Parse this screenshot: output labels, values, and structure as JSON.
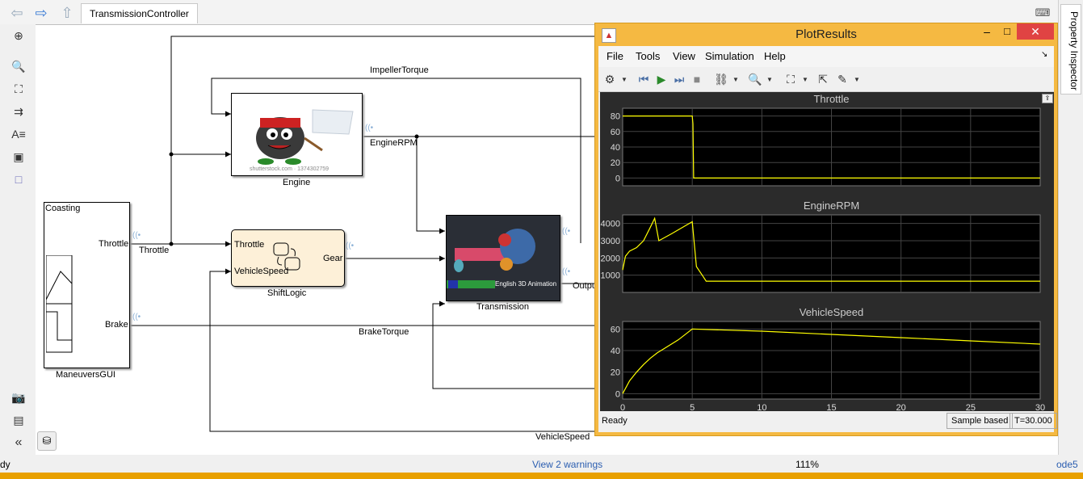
{
  "window": {
    "tab_title": "TransmissionController"
  },
  "property_inspector": {
    "label": "Property Inspector"
  },
  "status_bar": {
    "left": "dy",
    "warnings": "View 2 warnings",
    "zoom": "111%",
    "solver": "ode5"
  },
  "blocks": {
    "maneuvers": {
      "name": "ManeuversGUI",
      "header": "Coasting",
      "port_throttle": "Throttle",
      "port_brake": "Brake"
    },
    "engine": {
      "name": "Engine",
      "watermark": "shutterstock.com · 1374302759"
    },
    "shiftlogic": {
      "name": "ShiftLogic",
      "in_throttle": "Throttle",
      "in_vehiclespeed": "VehicleSpeed",
      "out_gear": "Gear"
    },
    "transmission": {
      "name": "Transmission",
      "badge": "English 3D Animation"
    }
  },
  "signals": {
    "impeller_torque": "ImpellerTorque",
    "engine_rpm": "EngineRPM",
    "throttle": "Throttle",
    "brake_torque": "BrakeTorque",
    "output": "Outpu",
    "vehicle_speed": "VehicleSpeed"
  },
  "plot_window": {
    "title": "PlotResults",
    "menu": [
      "File",
      "Tools",
      "View",
      "Simulation",
      "Help"
    ],
    "status_left": "Ready",
    "sample_mode": "Sample based",
    "time": "T=30.000"
  },
  "colors": {
    "trace": "#ffff00",
    "plot_bg": "#000000",
    "titlebar": "#f5b942",
    "close": "#e04343"
  },
  "chart_data": [
    {
      "type": "line",
      "title": "Throttle",
      "xlim": [
        0,
        30
      ],
      "ylim": [
        -10,
        90
      ],
      "yticks": [
        0,
        20,
        40,
        60,
        80
      ],
      "x": [
        0,
        5,
        5.05,
        5.1,
        30
      ],
      "y": [
        80,
        80,
        70,
        0,
        0
      ]
    },
    {
      "type": "line",
      "title": "EngineRPM",
      "xlim": [
        0,
        30
      ],
      "ylim": [
        0,
        4500
      ],
      "yticks": [
        1000,
        2000,
        3000,
        4000
      ],
      "x": [
        0,
        0.2,
        0.5,
        1,
        1.5,
        2,
        2.3,
        2.6,
        3.5,
        5,
        5.3,
        5.8,
        6,
        30
      ],
      "y": [
        1300,
        2100,
        2400,
        2600,
        3000,
        3800,
        4300,
        3000,
        3400,
        4100,
        1500,
        900,
        650,
        650
      ]
    },
    {
      "type": "line",
      "title": "VehicleSpeed",
      "xlim": [
        0,
        30
      ],
      "ylim": [
        -5,
        67
      ],
      "yticks": [
        0,
        20,
        40,
        60
      ],
      "xticks": [
        0,
        5,
        10,
        15,
        20,
        25,
        30
      ],
      "x": [
        0,
        0.5,
        1,
        1.5,
        2,
        2.5,
        3,
        4,
        5,
        10,
        15,
        20,
        25,
        30
      ],
      "y": [
        0,
        12,
        20,
        27,
        33,
        38,
        42,
        50,
        60,
        58,
        55,
        52,
        49,
        46
      ]
    }
  ]
}
